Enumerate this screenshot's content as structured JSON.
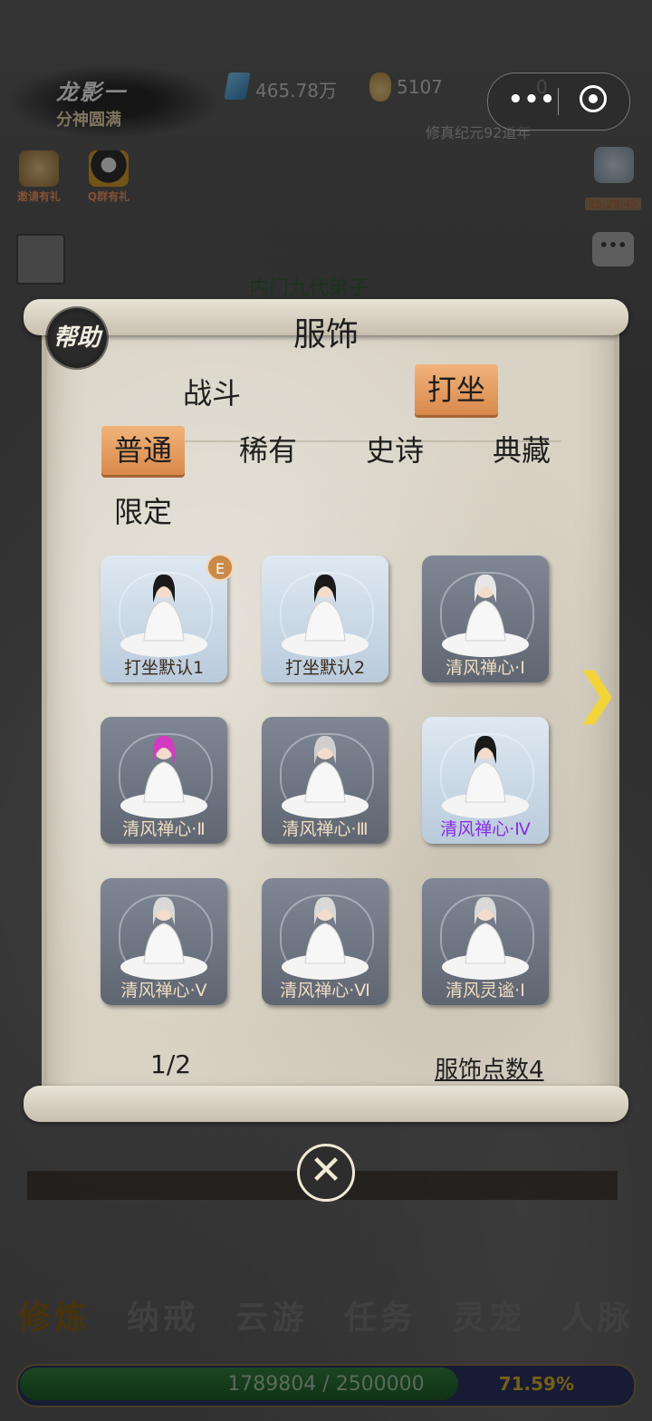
{
  "player": {
    "name": "龙影一",
    "realm": "分神圆满"
  },
  "resources": {
    "gems": "465.78万",
    "coins": "5107",
    "third": "0"
  },
  "era": "修真纪元92道年",
  "capsule": {
    "more": "•••"
  },
  "side_buttons": {
    "invite": "邀请有礼",
    "qq_group": "Q群有礼"
  },
  "timer": "15:29:45",
  "disciple_rank": "内门九代弟子",
  "modal": {
    "help": "帮助",
    "title": "服饰",
    "main_tabs": [
      "战斗",
      "打坐"
    ],
    "active_main_tab": "打坐",
    "rarity_tabs": [
      "普通",
      "稀有",
      "史诗",
      "典藏",
      "限定"
    ],
    "active_rarity_tab": "普通",
    "items": [
      {
        "name": "打坐默认1",
        "equipped": "E",
        "style": "light"
      },
      {
        "name": "打坐默认2",
        "style": "light"
      },
      {
        "name": "清风禅心·Ⅰ",
        "style": "dark"
      },
      {
        "name": "清风禅心·Ⅱ",
        "style": "dark"
      },
      {
        "name": "清风禅心·Ⅲ",
        "style": "dark"
      },
      {
        "name": "清风禅心·Ⅳ",
        "style": "light",
        "highlight_color": "#8a2be2"
      },
      {
        "name": "清风禅心·Ⅴ",
        "style": "dark"
      },
      {
        "name": "清风禅心·Ⅵ",
        "style": "dark"
      },
      {
        "name": "清风灵谧·Ⅰ",
        "style": "dark"
      }
    ],
    "page": "1/2",
    "points": "服饰点数4",
    "next_icon": "chevron-right-icon",
    "close_icon": "close-icon"
  },
  "bottom_tabs": [
    "修炼",
    "纳戒",
    "云游",
    "任务",
    "灵宠",
    "人脉"
  ],
  "active_bottom_tab": "修炼",
  "progress": {
    "text": "1789804 / 2500000",
    "percent": "71.59%",
    "fraction": 0.7159
  },
  "colors": {
    "accent": "#d9894b",
    "purple": "#8a2be2",
    "arrow": "#f2d43a"
  }
}
